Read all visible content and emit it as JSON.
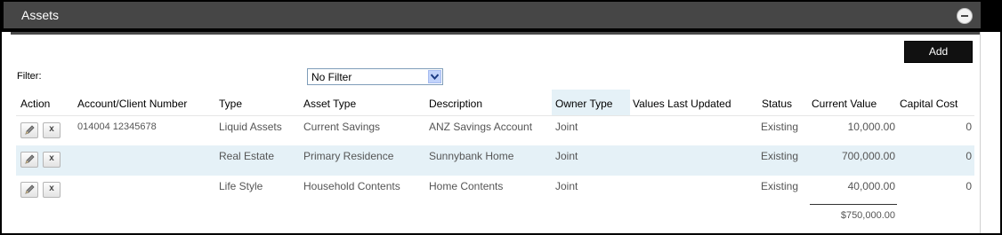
{
  "panel": {
    "title": "Assets",
    "collapse_icon": "minus-circle-icon",
    "add_label": "Add"
  },
  "filter": {
    "label": "Filter:",
    "selected": "No Filter"
  },
  "table": {
    "columns": [
      "Action",
      "Account/Client Number",
      "Type",
      "Asset Type",
      "Description",
      "Owner Type",
      "Values Last Updated",
      "Status",
      "Current Value",
      "Capital Cost"
    ],
    "rows": [
      {
        "account": "014004 12345678",
        "type": "Liquid Assets",
        "asset_type": "Current Savings",
        "description": "ANZ Savings Account",
        "owner_type": "Joint",
        "values_last_updated": "",
        "status": "Existing",
        "current_value": "10,000.00",
        "capital_cost": "0"
      },
      {
        "account": "",
        "type": "Real Estate",
        "asset_type": "Primary Residence",
        "description": "Sunnybank Home",
        "owner_type": "Joint",
        "values_last_updated": "",
        "status": "Existing",
        "current_value": "700,000.00",
        "capital_cost": "0"
      },
      {
        "account": "",
        "type": "Life Style",
        "asset_type": "Household Contents",
        "description": "Home Contents",
        "owner_type": "Joint",
        "values_last_updated": "",
        "status": "Existing",
        "current_value": "40,000.00",
        "capital_cost": "0"
      }
    ],
    "total": "$750,000.00",
    "edit_icon": "pencil-icon",
    "delete_label": "x"
  },
  "colors": {
    "header_bg": "#464646",
    "row_highlight": "#e5f1f7",
    "button_bg": "#111111"
  }
}
